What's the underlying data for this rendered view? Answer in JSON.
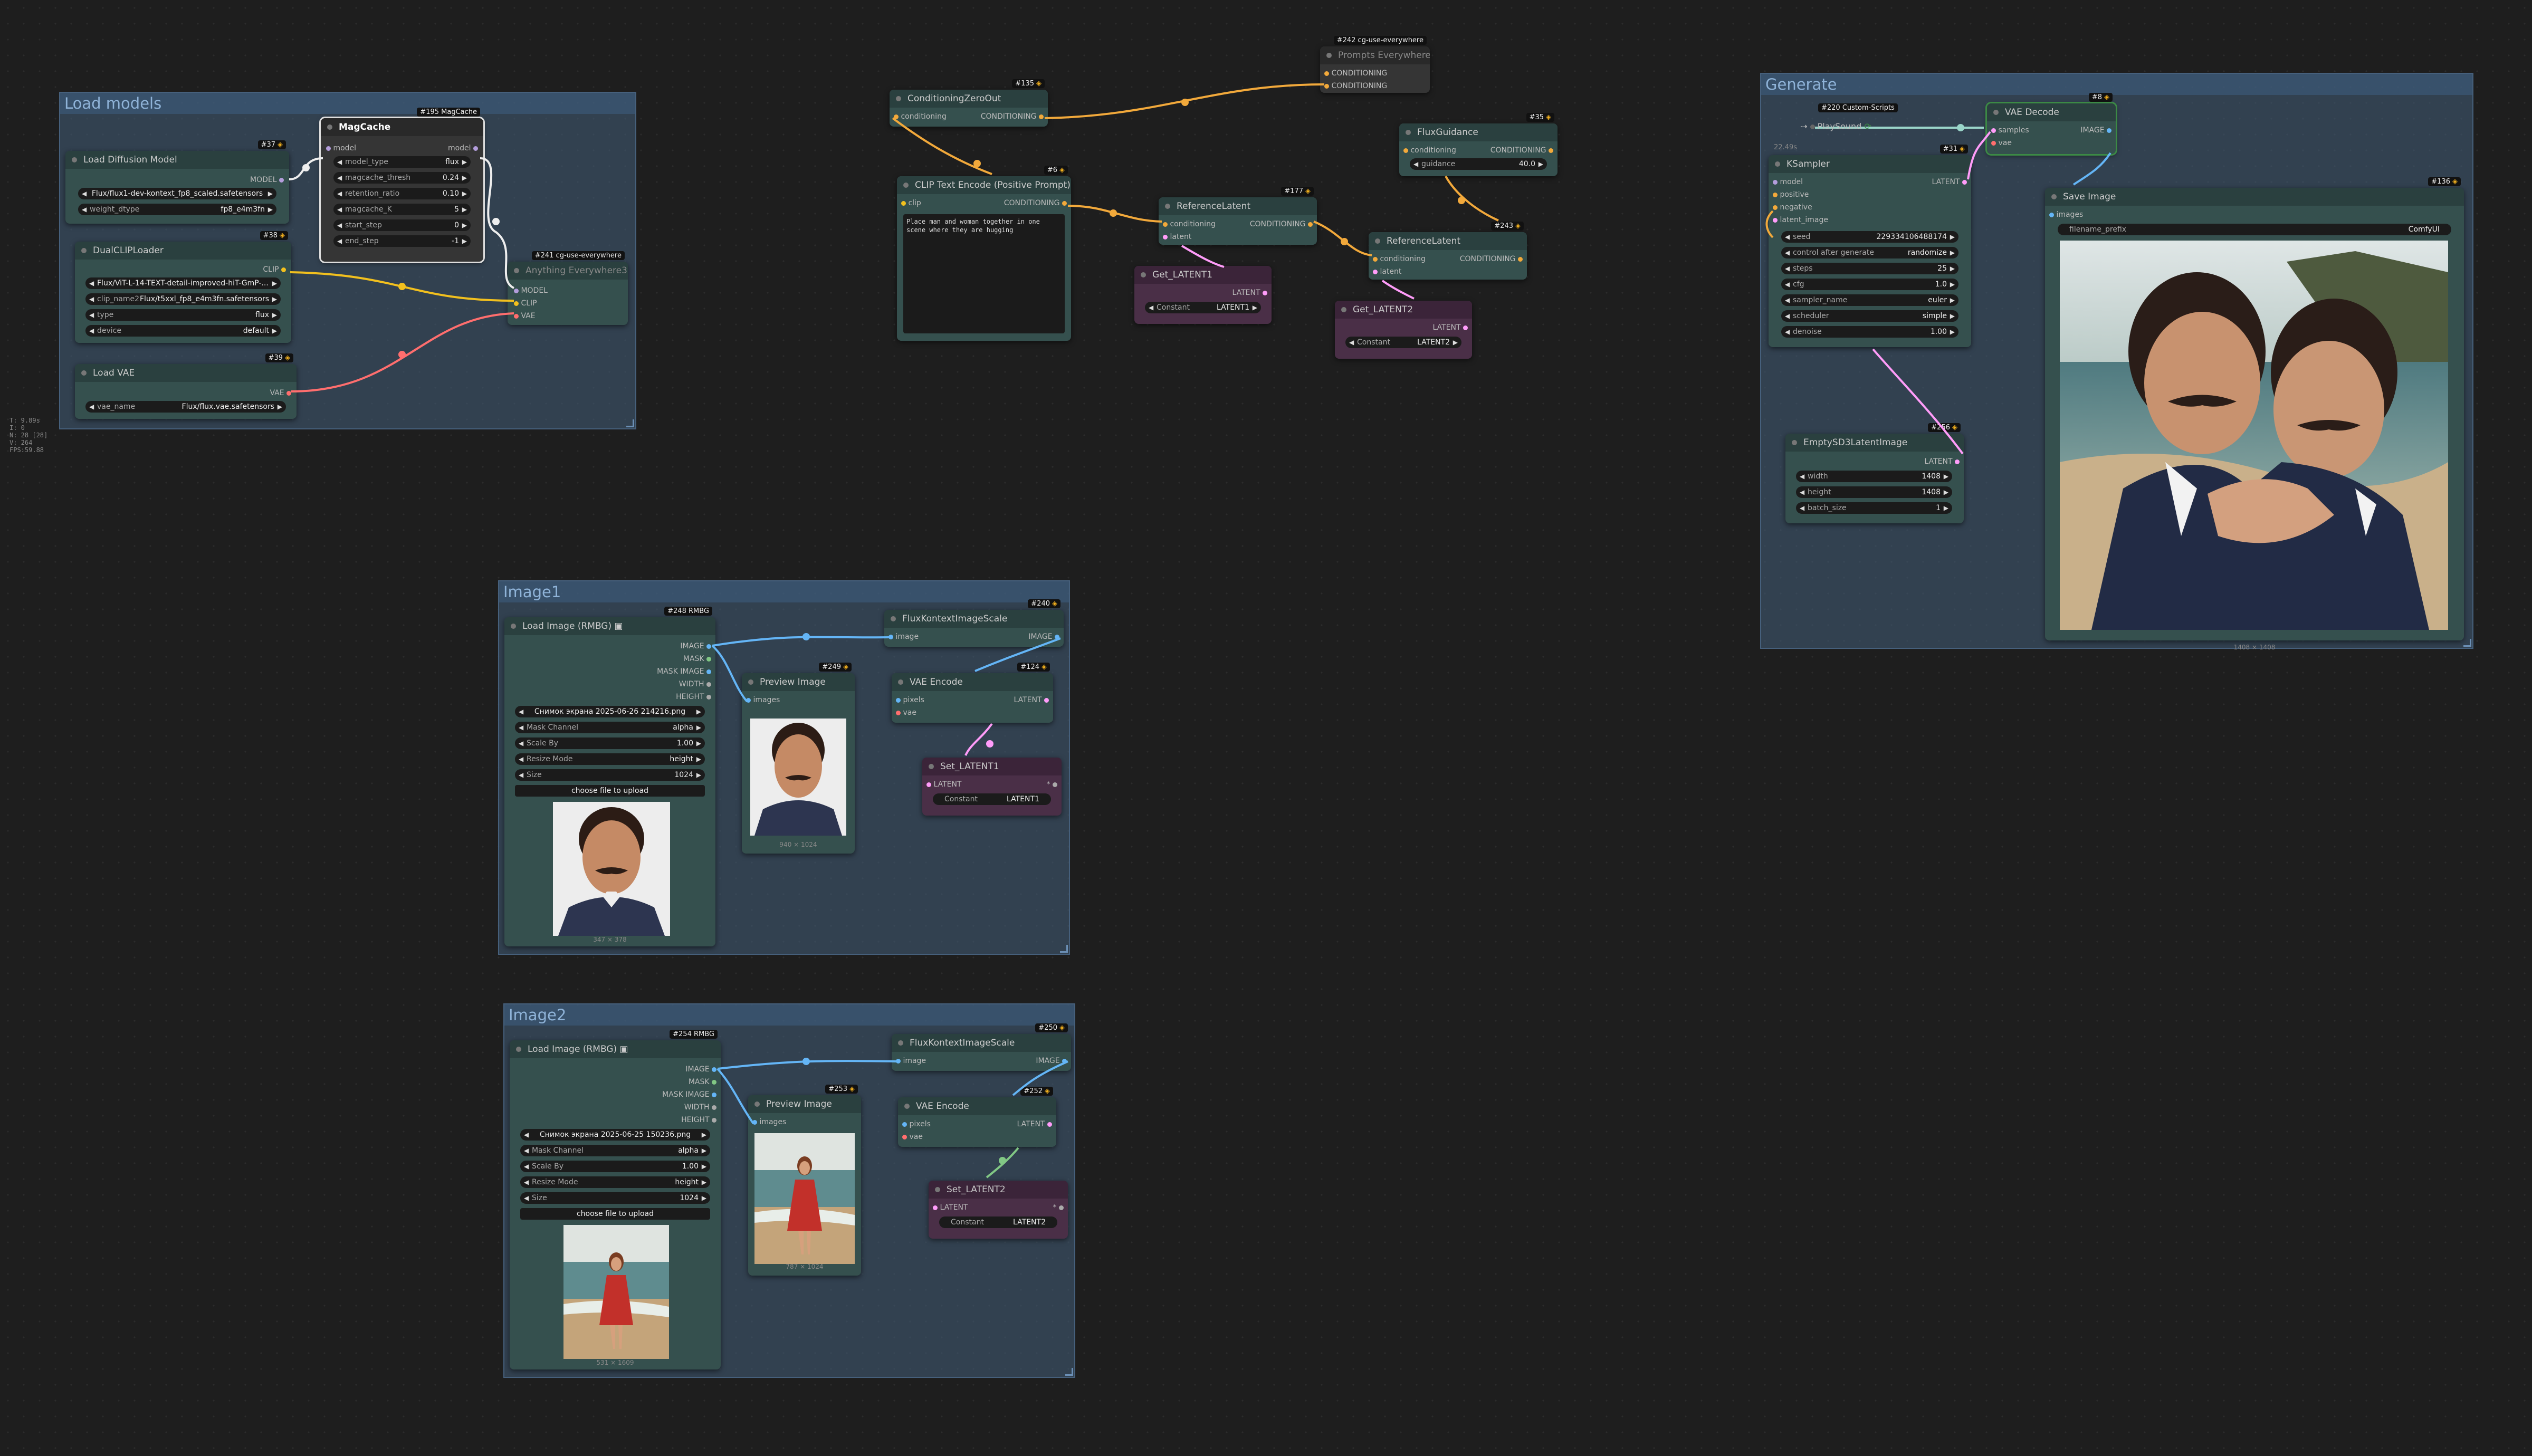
{
  "stats": {
    "lines": [
      "T: 9.89s",
      "I: 0",
      "N: 28 [28]",
      "V: 264",
      "FPS:59.88"
    ]
  },
  "groups": {
    "load_models": "Load models",
    "image1": "Image1",
    "image2": "Image2",
    "generate": "Generate"
  },
  "nodes": {
    "load_diffusion": {
      "title": "Load Diffusion Model",
      "badge": "#37",
      "out": "MODEL",
      "widgets": [
        {
          "label": "",
          "value": "Flux/flux1-dev-kontext_fp8_scaled.safetensors"
        },
        {
          "label": "weight_dtype",
          "value": "fp8_e4m3fn"
        }
      ]
    },
    "magcache": {
      "title": "MagCache",
      "badge": "#195 MagCache",
      "in": "model",
      "out": "model",
      "widgets": [
        {
          "label": "model_type",
          "value": "flux"
        },
        {
          "label": "magcache_thresh",
          "value": "0.24"
        },
        {
          "label": "retention_ratio",
          "value": "0.10"
        },
        {
          "label": "magcache_K",
          "value": "5"
        },
        {
          "label": "start_step",
          "value": "0"
        },
        {
          "label": "end_step",
          "value": "-1"
        }
      ]
    },
    "dualclip": {
      "title": "DualCLIPLoader",
      "badge": "#38",
      "out": "CLIP",
      "widgets": [
        {
          "label": "",
          "value": "Flux/ViT-L-14-TEXT-detail-improved-hiT-GmP-..."
        },
        {
          "label": "clip_name2",
          "value": "Flux/t5xxl_fp8_e4m3fn.safetensors"
        },
        {
          "label": "type",
          "value": "flux"
        },
        {
          "label": "device",
          "value": "default"
        }
      ]
    },
    "anything_everywhere": {
      "title": "Anything Everywhere3",
      "badge": "#241 cg-use-everywhere",
      "inputs": [
        "MODEL",
        "CLIP",
        "VAE"
      ]
    },
    "load_vae": {
      "title": "Load VAE",
      "badge": "#39",
      "out": "VAE",
      "widgets": [
        {
          "label": "vae_name",
          "value": "Flux/flux.vae.safetensors"
        }
      ]
    },
    "cond_zero": {
      "title": "ConditioningZeroOut",
      "badge": "#135",
      "in": "conditioning",
      "out": "CONDITIONING"
    },
    "clip_encode": {
      "title": "CLIP Text Encode (Positive Prompt)",
      "badge": "#6",
      "in": "clip",
      "out": "CONDITIONING",
      "text": "Place man and woman together in one scene where they are hugging"
    },
    "prompts_everywhere": {
      "title": "Prompts Everywhere",
      "badge": "#242 cg-use-everywhere",
      "inputs": [
        "CONDITIONING",
        "CONDITIONING"
      ]
    },
    "flux_guidance": {
      "title": "FluxGuidance",
      "badge": "#35",
      "in": "conditioning",
      "out": "CONDITIONING",
      "widgets": [
        {
          "label": "guidance",
          "value": "40.0"
        }
      ]
    },
    "ref_latent1": {
      "title": "ReferenceLatent",
      "badge": "#177",
      "inputs": [
        "conditioning",
        "latent"
      ],
      "out": "CONDITIONING"
    },
    "ref_latent2": {
      "title": "ReferenceLatent",
      "badge": "#243",
      "inputs": [
        "conditioning",
        "latent"
      ],
      "out": "CONDITIONING"
    },
    "get_latent1": {
      "title": "Get_LATENT1",
      "out": "LATENT",
      "widgets": [
        {
          "label": "Constant",
          "value": "LATENT1"
        }
      ]
    },
    "get_latent2": {
      "title": "Get_LATENT2",
      "out": "LATENT",
      "widgets": [
        {
          "label": "Constant",
          "value": "LATENT2"
        }
      ]
    },
    "custom_scripts": {
      "badge": "#220 Custom-Scripts",
      "title": "PlaySound",
      "extra": "22.49s"
    },
    "ksampler": {
      "title": "KSampler",
      "badge": "#31",
      "out": "LATENT",
      "inputs": [
        "model",
        "positive",
        "negative",
        "latent_image"
      ],
      "widgets": [
        {
          "label": "seed",
          "value": "229334106488174"
        },
        {
          "label": "control after generate",
          "value": "randomize"
        },
        {
          "label": "steps",
          "value": "25"
        },
        {
          "label": "cfg",
          "value": "1.0"
        },
        {
          "label": "sampler_name",
          "value": "euler"
        },
        {
          "label": "scheduler",
          "value": "simple"
        },
        {
          "label": "denoise",
          "value": "1.00"
        }
      ]
    },
    "vae_decode": {
      "title": "VAE Decode",
      "badge": "#8",
      "inputs": [
        "samples",
        "vae"
      ],
      "out": "IMAGE"
    },
    "save_image": {
      "title": "Save Image",
      "badge": "#136",
      "in": "images",
      "widgets": [
        {
          "label": "filename_prefix",
          "value": "ComfyUI"
        }
      ],
      "caption": "1408 × 1408"
    },
    "empty_latent": {
      "title": "EmptySD3LatentImage",
      "badge": "#256",
      "out": "LATENT",
      "widgets": [
        {
          "label": "width",
          "value": "1408"
        },
        {
          "label": "height",
          "value": "1408"
        },
        {
          "label": "batch_size",
          "value": "1"
        }
      ]
    },
    "load_image1": {
      "title": "Load Image (RMBG)",
      "badge": "#248 RMBG",
      "outputs": [
        "IMAGE",
        "MASK",
        "MASK IMAGE",
        "WIDTH",
        "HEIGHT"
      ],
      "widgets": [
        {
          "label": "",
          "value": "Снимок экрана 2025-06-26 214216.png"
        },
        {
          "label": "Mask Channel",
          "value": "alpha"
        },
        {
          "label": "Scale By",
          "value": "1.00"
        },
        {
          "label": "Resize Mode",
          "value": "height"
        },
        {
          "label": "Size",
          "value": "1024"
        }
      ],
      "upload": "choose file to upload",
      "caption": "347 × 378"
    },
    "preview1": {
      "title": "Preview Image",
      "badge": "#249",
      "in": "images",
      "caption": "940 × 1024"
    },
    "flux_scale1": {
      "title": "FluxKontextImageScale",
      "badge": "#240",
      "in": "image",
      "out": "IMAGE"
    },
    "vae_encode1": {
      "title": "VAE Encode",
      "badge": "#124",
      "inputs": [
        "pixels",
        "vae"
      ],
      "out": "LATENT"
    },
    "set_latent1": {
      "title": "Set_LATENT1",
      "in": "LATENT",
      "out": "*",
      "widgets": [
        {
          "label": "Constant",
          "value": "LATENT1"
        }
      ]
    },
    "load_image2": {
      "title": "Load Image (RMBG)",
      "badge": "#254 RMBG",
      "outputs": [
        "IMAGE",
        "MASK",
        "MASK IMAGE",
        "WIDTH",
        "HEIGHT"
      ],
      "widgets": [
        {
          "label": "",
          "value": "Снимок экрана 2025-06-25 150236.png"
        },
        {
          "label": "Mask Channel",
          "value": "alpha"
        },
        {
          "label": "Scale By",
          "value": "1.00"
        },
        {
          "label": "Resize Mode",
          "value": "height"
        },
        {
          "label": "Size",
          "value": "1024"
        }
      ],
      "upload": "choose file to upload",
      "caption": "531 × 1609"
    },
    "preview2": {
      "title": "Preview Image",
      "badge": "#253",
      "in": "images",
      "caption": "787 × 1024"
    },
    "flux_scale2": {
      "title": "FluxKontextImageScale",
      "badge": "#250",
      "in": "image",
      "out": "IMAGE"
    },
    "vae_encode2": {
      "title": "VAE Encode",
      "badge": "#252",
      "inputs": [
        "pixels",
        "vae"
      ],
      "out": "LATENT"
    },
    "set_latent2": {
      "title": "Set_LATENT2",
      "in": "LATENT",
      "out": "*",
      "widgets": [
        {
          "label": "Constant",
          "value": "LATENT2"
        }
      ]
    }
  },
  "colors": {
    "clip": "#f2c01e",
    "conditioning": "#f2a93b",
    "vae": "#ff6e6e",
    "model": "#b39ddb",
    "latent": "#ff9cf9",
    "image": "#64b5f6",
    "mask": "#81c784",
    "white_wire": "#eeeeee"
  },
  "icons": [
    "node-dot-icon",
    "bypass-icon",
    "arrow-left-icon",
    "arrow-right-icon",
    "resize-handle-icon"
  ]
}
